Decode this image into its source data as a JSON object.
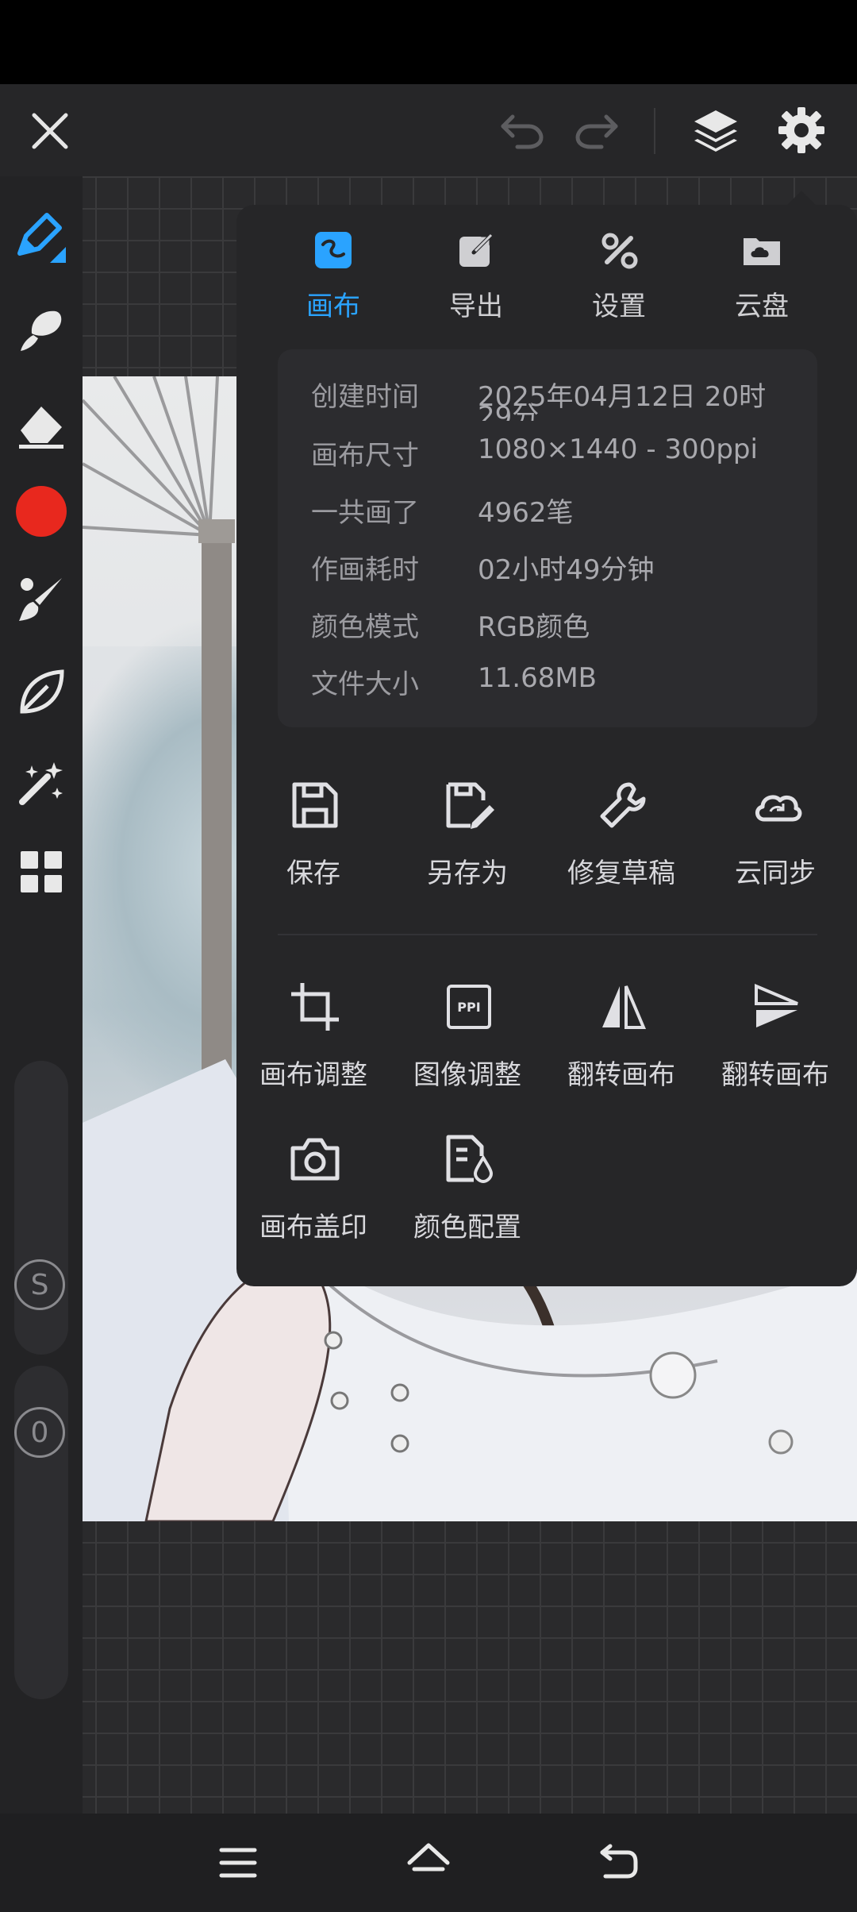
{
  "colors": {
    "accent": "#2aa3ff",
    "color_swatch": "#e8281e",
    "bg_dark": "#262628"
  },
  "topbar": {
    "close_icon": "close-icon",
    "undo_icon": "undo-icon",
    "redo_icon": "redo-icon",
    "layers_icon": "layers-icon",
    "settings_icon": "gear-icon"
  },
  "tools": [
    "pen-icon",
    "brush-icon",
    "eraser-icon",
    "color-swatch",
    "paint-brush-icon",
    "leaf-icon",
    "magic-wand-icon",
    "grid-icon"
  ],
  "sliders": {
    "s_label": "S",
    "o_label": "0"
  },
  "menu": {
    "tabs": [
      {
        "label": "画布",
        "icon": "canvas-icon",
        "active": true
      },
      {
        "label": "导出",
        "icon": "export-icon",
        "active": false
      },
      {
        "label": "设置",
        "icon": "tools-icon",
        "active": false
      },
      {
        "label": "云盘",
        "icon": "cloud-folder-icon",
        "active": false
      }
    ],
    "info": [
      {
        "key": "创建时间",
        "value": "2025年04月12日 20时"
      },
      {
        "key": "画布尺寸",
        "value": "1080×1440 - 300ppi"
      },
      {
        "key": "一共画了",
        "value": "4962笔"
      },
      {
        "key": "作画耗时",
        "value": "02小时49分钟"
      },
      {
        "key": "颜色模式",
        "value": "RGB颜色"
      },
      {
        "key": "文件大小",
        "value": "11.68MB"
      }
    ],
    "created_overflow": "29分",
    "actions_row1": [
      {
        "label": "保存",
        "icon": "save-icon"
      },
      {
        "label": "另存为",
        "icon": "save-as-icon"
      },
      {
        "label": "修复草稿",
        "icon": "wrench-icon"
      },
      {
        "label": "云同步",
        "icon": "cloud-sync-icon"
      }
    ],
    "actions_row2": [
      {
        "label": "画布调整",
        "icon": "crop-icon"
      },
      {
        "label": "图像调整",
        "icon": "ppi-icon",
        "icon_text": "PPI"
      },
      {
        "label": "翻转画布",
        "icon": "flip-horizontal-icon"
      },
      {
        "label": "翻转画布",
        "icon": "flip-vertical-icon"
      }
    ],
    "actions_row3": [
      {
        "label": "画布盖印",
        "icon": "camera-icon"
      },
      {
        "label": "颜色配置",
        "icon": "color-config-icon"
      }
    ]
  },
  "navbar": {
    "menu_icon": "menu-icon",
    "home_icon": "home-icon",
    "back_icon": "back-icon"
  }
}
